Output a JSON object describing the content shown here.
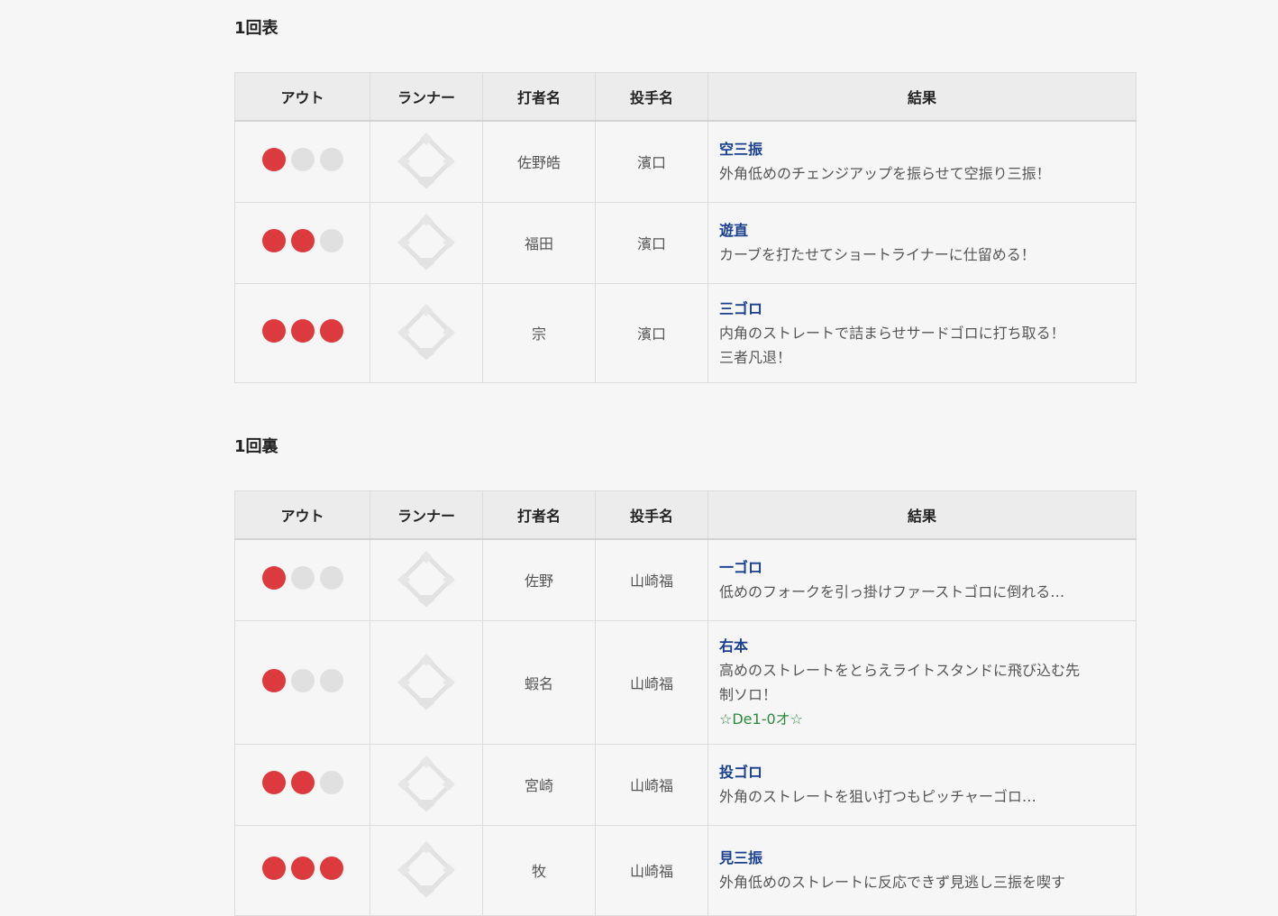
{
  "columns": {
    "out": "アウト",
    "runner": "ランナー",
    "batter": "打者名",
    "pitcher": "投手名",
    "result": "結果"
  },
  "colors": {
    "out_on": "#dc3a3f",
    "out_off": "#e0e0e0",
    "result_type": "#1a3f8f",
    "score": "#2e8b3e"
  },
  "innings": [
    {
      "title": "1回表",
      "rows": [
        {
          "outs": 1,
          "batter": "佐野皓",
          "pitcher": "濱口",
          "result_type": "空三振",
          "desc": [
            "外角低めのチェンジアップを振らせて空振り三振！"
          ]
        },
        {
          "outs": 2,
          "batter": "福田",
          "pitcher": "濱口",
          "result_type": "遊直",
          "desc": [
            "カーブを打たせてショートライナーに仕留める！"
          ]
        },
        {
          "outs": 3,
          "batter": "宗",
          "pitcher": "濱口",
          "result_type": "三ゴロ",
          "desc": [
            "内角のストレートで詰まらせサードゴロに打ち取る！",
            "三者凡退！"
          ]
        }
      ]
    },
    {
      "title": "1回裏",
      "rows": [
        {
          "outs": 1,
          "batter": "佐野",
          "pitcher": "山崎福",
          "result_type": "一ゴロ",
          "desc": [
            "低めのフォークを引っ掛けファーストゴロに倒れる…"
          ]
        },
        {
          "outs": 1,
          "batter": "蝦名",
          "pitcher": "山崎福",
          "result_type": "右本",
          "desc": [
            "高めのストレートをとらえライトスタンドに飛び込む先",
            "制ソロ！"
          ],
          "score": "☆De1-0オ☆"
        },
        {
          "outs": 2,
          "batter": "宮崎",
          "pitcher": "山崎福",
          "result_type": "投ゴロ",
          "desc": [
            "外角のストレートを狙い打つもピッチャーゴロ…"
          ]
        },
        {
          "outs": 3,
          "batter": "牧",
          "pitcher": "山崎福",
          "result_type": "見三振",
          "desc": [
            "外角低めのストレートに反応できず見逃し三振を喫す"
          ]
        }
      ]
    }
  ]
}
